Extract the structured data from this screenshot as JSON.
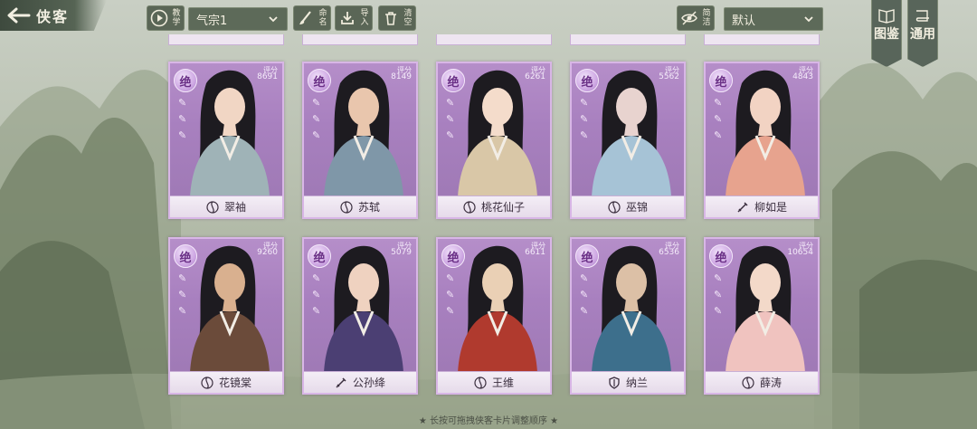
{
  "header": {
    "back_label": "侠客"
  },
  "toolbar": {
    "tutorial_label": "教学",
    "preset_select": {
      "value": "气宗1"
    },
    "rename_label": "命名",
    "import_label": "导入",
    "clear_label": "清空",
    "simple_label": "简洁",
    "sort_select": {
      "value": "默认"
    }
  },
  "side_tabs": {
    "gallery_label": "图鉴",
    "general_label": "通用"
  },
  "score_label": "评分",
  "cards": [
    {
      "rank": "绝",
      "score": "8691",
      "name": "翠袖",
      "school": "swirl"
    },
    {
      "rank": "绝",
      "score": "8149",
      "name": "苏轼",
      "school": "swirl"
    },
    {
      "rank": "绝",
      "score": "6261",
      "name": "桃花仙子",
      "school": "swirl"
    },
    {
      "rank": "绝",
      "score": "5562",
      "name": "巫锦",
      "school": "swirl"
    },
    {
      "rank": "绝",
      "score": "4843",
      "name": "柳如是",
      "school": "sword"
    },
    {
      "rank": "绝",
      "score": "9260",
      "name": "花镜棠",
      "school": "swirl"
    },
    {
      "rank": "绝",
      "score": "5079",
      "name": "公孙绛",
      "school": "sword"
    },
    {
      "rank": "绝",
      "score": "6611",
      "name": "王维",
      "school": "swirl"
    },
    {
      "rank": "绝",
      "score": "6536",
      "name": "纳兰",
      "school": "shield"
    },
    {
      "rank": "绝",
      "score": "10654",
      "name": "薛涛",
      "school": "swirl"
    }
  ],
  "hint": "★ 长按可拖拽侠客卡片调整顺序 ★",
  "colors": {
    "card_purple": "#a880bf",
    "toolbar_green": "#5a6656",
    "nameplate": "#f4eef6"
  }
}
